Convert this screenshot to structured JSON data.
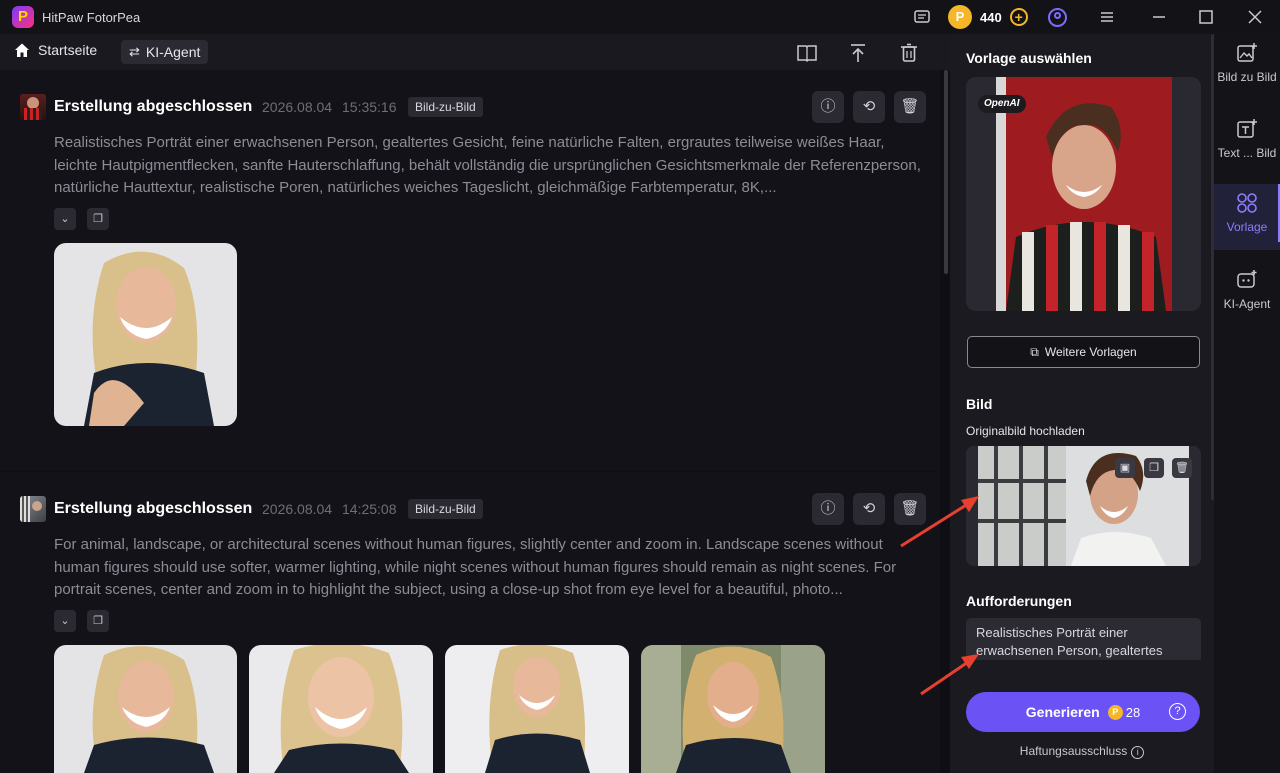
{
  "app": {
    "title": "HitPaw FotorPea",
    "logo_letter": "P",
    "credits": "440",
    "coin_symbol": "P"
  },
  "nav": {
    "home_label": "Startseite",
    "agent_label": "KI-Agent"
  },
  "cards": [
    {
      "status": "Erstellung abgeschlossen",
      "date": "2026.08.04",
      "time": "15:35:16",
      "tag": "Bild-zu-Bild",
      "prompt": "Realistisches Porträt einer erwachsenen Person, gealtertes Gesicht, feine natürliche Falten, ergrautes teilweise weißes Haar, leichte Hautpigmentflecken, sanfte Hauterschlaffung, behält vollständig die ursprünglichen Gesichtsmerkmale der Referenzperson, natürliche Hauttextur, realistische Poren, natürliches weiches Tageslicht, gleichmäßige Farbtemperatur, 8K,..."
    },
    {
      "status": "Erstellung abgeschlossen",
      "date": "2026.08.04",
      "time": "14:25:08",
      "tag": "Bild-zu-Bild",
      "prompt": "For animal, landscape, or architectural scenes without human figures, slightly center and zoom in. Landscape scenes without human figures should use softer, warmer lighting, while night scenes without human figures should remain as night scenes. For portrait scenes, center and zoom in to highlight the subject, using a close-up shot from eye level for a beautiful, photo..."
    }
  ],
  "panel": {
    "template_title": "Vorlage auswählen",
    "template_badge": "OpenAI",
    "more_templates": "Weitere Vorlagen",
    "image_title": "Bild",
    "upload_label": "Originalbild hochladen",
    "prompts_title": "Aufforderungen",
    "prompt_text": "Realistisches Porträt einer erwachsenen Person, gealtertes",
    "generate_label": "Generieren",
    "generate_cost": "28",
    "disclaimer": "Haftungsausschluss"
  },
  "sidebar": {
    "items": [
      {
        "label": "Bild zu Bild"
      },
      {
        "label": "Text ... Bild"
      },
      {
        "label": "Vorlage"
      },
      {
        "label": "KI-Agent"
      }
    ]
  },
  "colors": {
    "accent": "#6a52f5",
    "coin": "#f5b62a",
    "active": "#8e7bff",
    "arrow": "#e8402f"
  }
}
